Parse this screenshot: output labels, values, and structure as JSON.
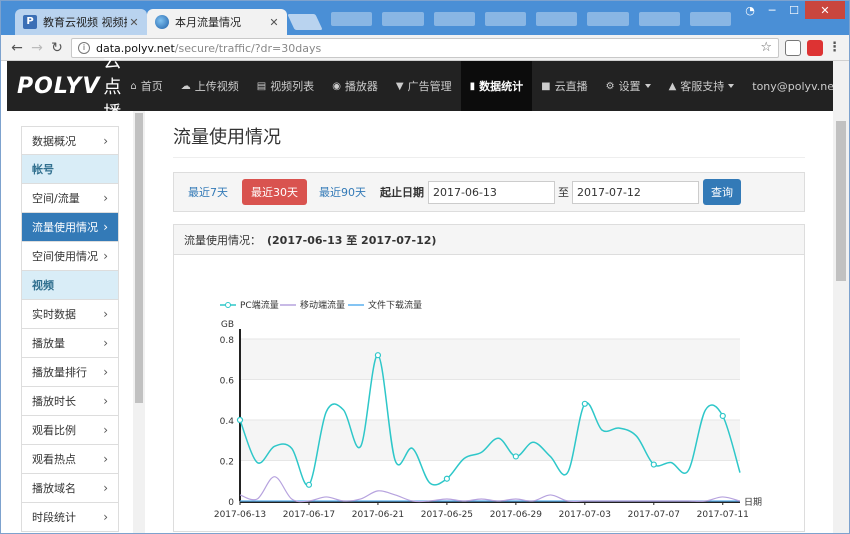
{
  "browser": {
    "tabs": [
      {
        "title": "教育云视频 视频托管_"
      },
      {
        "title": "本月流量情况"
      }
    ],
    "url_host": "data.polyv.net",
    "url_path": "/secure/traffic/?dr=30days"
  },
  "nav": {
    "brand": "POLYV",
    "brand_cn": "云点播",
    "items": [
      {
        "label": "首页",
        "icon": "home-icon"
      },
      {
        "label": "上传视频",
        "icon": "upload-icon"
      },
      {
        "label": "视频列表",
        "icon": "film-icon"
      },
      {
        "label": "播放器",
        "icon": "play-circle-icon"
      },
      {
        "label": "广告管理",
        "icon": "filter-icon"
      },
      {
        "label": "数据统计",
        "icon": "bar-chart-icon"
      },
      {
        "label": "云直播",
        "icon": "video-camera-icon"
      }
    ],
    "right": [
      {
        "label": "设置",
        "icon": "gear-icon"
      },
      {
        "label": "客服支持",
        "icon": "bell-icon"
      },
      {
        "label": "tony@polyv.net"
      }
    ]
  },
  "sidebar": {
    "items": [
      {
        "label": "数据概况",
        "type": "link"
      },
      {
        "label": "帐号",
        "type": "header"
      },
      {
        "label": "空间/流量",
        "type": "link"
      },
      {
        "label": "流量使用情况",
        "type": "active"
      },
      {
        "label": "空间使用情况",
        "type": "link"
      },
      {
        "label": "视频",
        "type": "header"
      },
      {
        "label": "实时数据",
        "type": "link"
      },
      {
        "label": "播放量",
        "type": "link"
      },
      {
        "label": "播放量排行",
        "type": "link"
      },
      {
        "label": "播放时长",
        "type": "link"
      },
      {
        "label": "观看比例",
        "type": "link"
      },
      {
        "label": "观看热点",
        "type": "link"
      },
      {
        "label": "播放域名",
        "type": "link"
      },
      {
        "label": "时段统计",
        "type": "link"
      }
    ]
  },
  "page": {
    "title": "流量使用情况",
    "filter": {
      "last7": "最近7天",
      "last30": "最近30天",
      "last90": "最近90天",
      "date_label": "起止日期",
      "start": "2017-06-13",
      "to": "至",
      "end": "2017-07-12",
      "query": "查询"
    },
    "panel_label": "流量使用情况：",
    "panel_range": "(2017-06-13 至 2017-07-12)"
  },
  "colors": {
    "pc": "#2ec7c9",
    "mobile": "#b6a2de",
    "download": "#5ab1ef",
    "active_nav": "#0c0c0c",
    "danger": "#d9534f",
    "primary": "#337ab7"
  },
  "chart_data": {
    "type": "line",
    "ylabel": "GB",
    "xlabel": "日期",
    "ylim": [
      0,
      0.8
    ],
    "yticks": [
      "0",
      "0.2",
      "0.4",
      "0.6",
      "0.8"
    ],
    "legend": "top-left",
    "x": [
      "2017-06-13",
      "2017-06-14",
      "2017-06-15",
      "2017-06-16",
      "2017-06-17",
      "2017-06-18",
      "2017-06-19",
      "2017-06-20",
      "2017-06-21",
      "2017-06-22",
      "2017-06-23",
      "2017-06-24",
      "2017-06-25",
      "2017-06-26",
      "2017-06-27",
      "2017-06-28",
      "2017-06-29",
      "2017-06-30",
      "2017-07-01",
      "2017-07-02",
      "2017-07-03",
      "2017-07-04",
      "2017-07-05",
      "2017-07-06",
      "2017-07-07",
      "2017-07-08",
      "2017-07-09",
      "2017-07-10",
      "2017-07-11",
      "2017-07-12"
    ],
    "xticks": [
      "2017-06-13",
      "2017-06-17",
      "2017-06-21",
      "2017-06-25",
      "2017-06-29",
      "2017-07-03",
      "2017-07-07",
      "2017-07-11"
    ],
    "series": [
      {
        "name": "PC端流量",
        "values": [
          0.4,
          0.19,
          0.27,
          0.26,
          0.08,
          0.44,
          0.45,
          0.27,
          0.72,
          0.2,
          0.26,
          0.09,
          0.11,
          0.21,
          0.24,
          0.31,
          0.22,
          0.29,
          0.22,
          0.14,
          0.48,
          0.35,
          0.36,
          0.32,
          0.18,
          0.19,
          0.15,
          0.45,
          0.42,
          0.14
        ]
      },
      {
        "name": "移动端流量",
        "values": [
          0.03,
          0.01,
          0.12,
          0.01,
          0.0,
          0.02,
          0.0,
          0.01,
          0.05,
          0.03,
          0.0,
          0.0,
          0.01,
          0.0,
          0.01,
          0.0,
          0.01,
          0.0,
          0.03,
          0.0,
          0.0,
          0.0,
          0.0,
          0.0,
          0.0,
          0.0,
          0.0,
          0.0,
          0.02,
          0.0
        ]
      },
      {
        "name": "文件下载流量",
        "values": [
          0,
          0,
          0,
          0,
          0,
          0,
          0,
          0,
          0,
          0,
          0,
          0,
          0,
          0,
          0,
          0,
          0,
          0,
          0,
          0,
          0,
          0,
          0,
          0,
          0,
          0,
          0,
          0,
          0,
          0
        ]
      }
    ]
  }
}
